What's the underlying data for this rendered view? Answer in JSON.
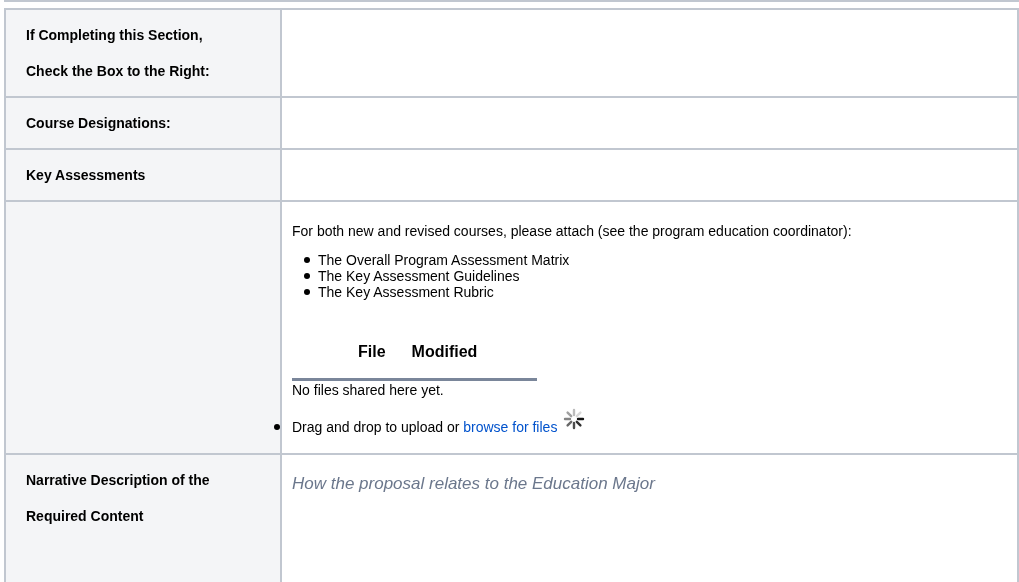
{
  "rows": [
    {
      "kind": "empty",
      "label_lines": [
        "If Completing this Section,",
        "Check the Box to the Right:"
      ]
    },
    {
      "kind": "empty",
      "label_lines": [
        "Course Designations:"
      ]
    },
    {
      "kind": "empty",
      "label_lines": [
        "Key Assessments"
      ]
    },
    {
      "kind": "attachments",
      "label_lines": [],
      "intro": "For both new and revised courses, please attach (see the program education coordinator):",
      "items": [
        "The Overall Program Assessment Matrix",
        "The Key Assessment Guidelines",
        "The Key Assessment Rubric"
      ],
      "file_columns": [
        "File",
        "Modified"
      ],
      "empty_message": "No files shared here yet.",
      "upload_text": "Drag and drop to upload or",
      "upload_link": "browse for files"
    },
    {
      "kind": "placeholder",
      "label_lines": [
        "Narrative Description of the",
        "Required Content"
      ],
      "placeholder": "How the proposal relates to the Education Major"
    }
  ]
}
